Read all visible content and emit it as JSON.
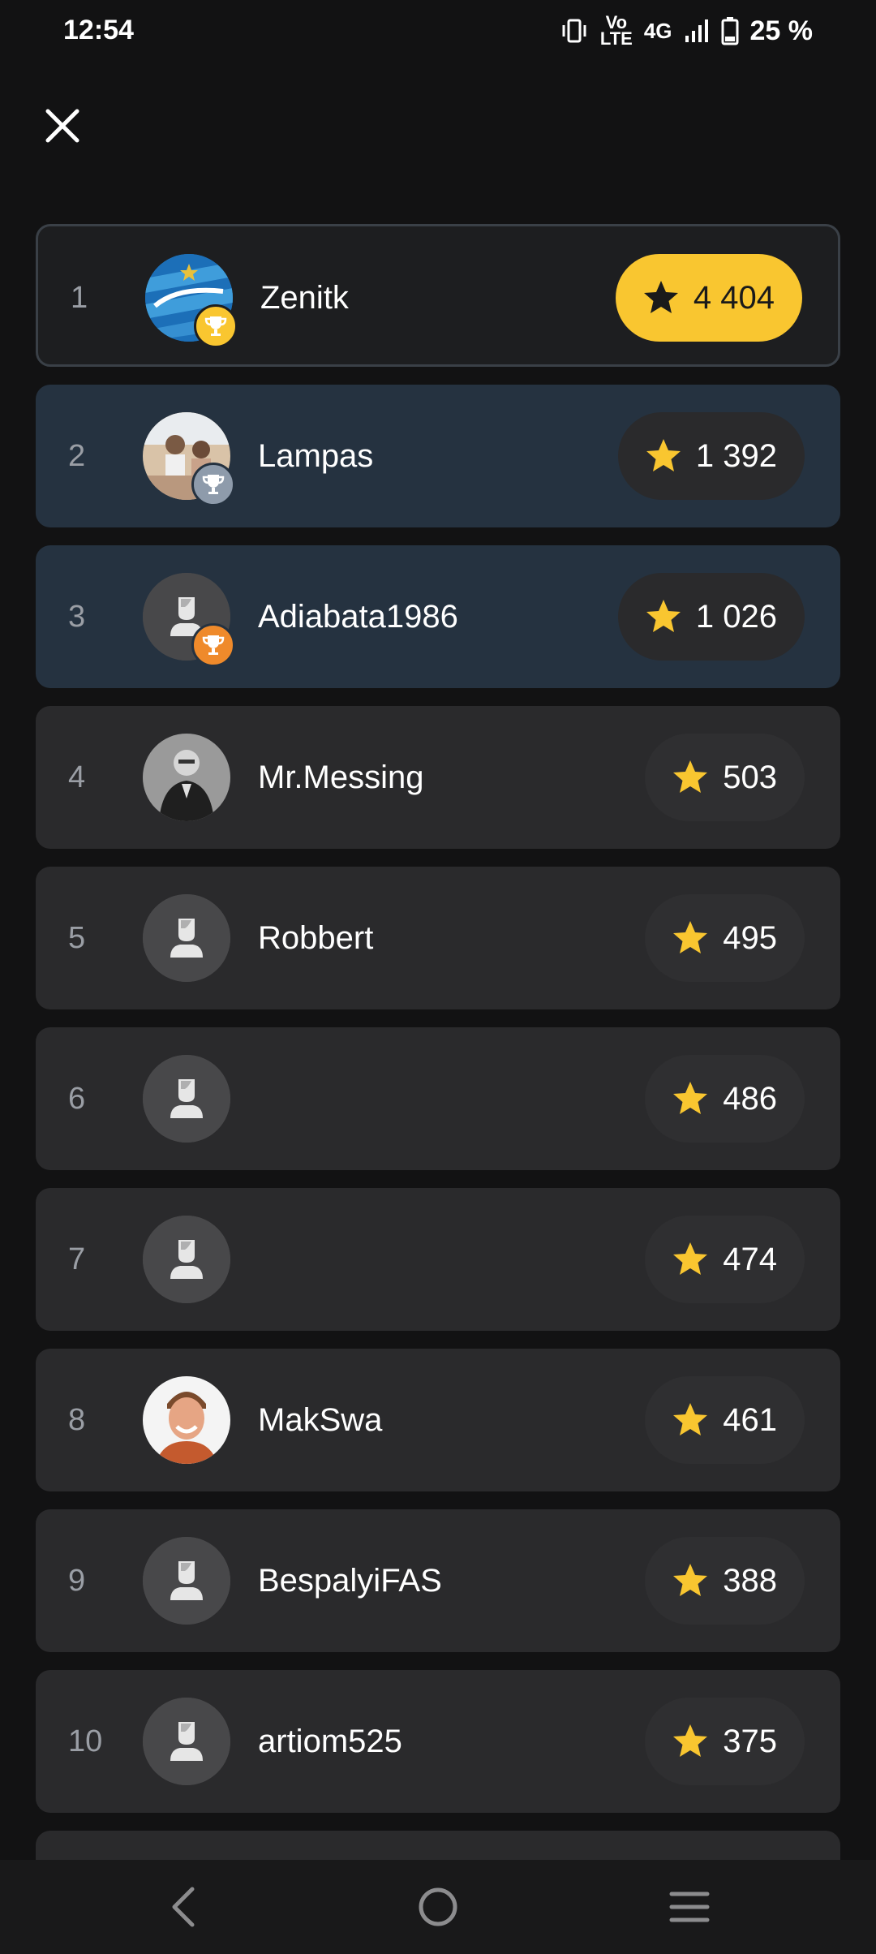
{
  "status": {
    "time": "12:54",
    "network": "4G",
    "volte_label_1": "Vo",
    "volte_label_2": "LTE",
    "battery_percent": "25 %"
  },
  "close_label": "close",
  "colors": {
    "accent": "#f9c630",
    "silver": "#8e9bab",
    "bronze": "#ef8a2b",
    "row_highlight": "#253240",
    "row": "#2a2a2c"
  },
  "leaderboard": [
    {
      "rank": "1",
      "name": "Zenitk",
      "score": "4 404",
      "trophy": "gold",
      "avatar": "zenit-logo"
    },
    {
      "rank": "2",
      "name": "Lampas",
      "score": "1 392",
      "trophy": "silver",
      "avatar": "photo-group"
    },
    {
      "rank": "3",
      "name": "Adiabata1986",
      "score": "1 026",
      "trophy": "bronze",
      "avatar": "default-user-icon"
    },
    {
      "rank": "4",
      "name": "Mr.Messing",
      "score": "503",
      "avatar": "photo-man"
    },
    {
      "rank": "5",
      "name": "Robbert",
      "score": "495",
      "avatar": "default-user-icon"
    },
    {
      "rank": "6",
      "name": "",
      "score": "486",
      "avatar": "default-user-icon"
    },
    {
      "rank": "7",
      "name": "",
      "score": "474",
      "avatar": "default-user-icon"
    },
    {
      "rank": "8",
      "name": "MakSwa",
      "score": "461",
      "avatar": "photo-smiling-man"
    },
    {
      "rank": "9",
      "name": "BespalyiFAS",
      "score": "388",
      "avatar": "default-user-icon"
    },
    {
      "rank": "10",
      "name": "artiom525",
      "score": "375",
      "avatar": "default-user-icon"
    }
  ],
  "nav": {
    "back": "back-icon",
    "home": "home-icon",
    "menu": "menu-icon"
  }
}
